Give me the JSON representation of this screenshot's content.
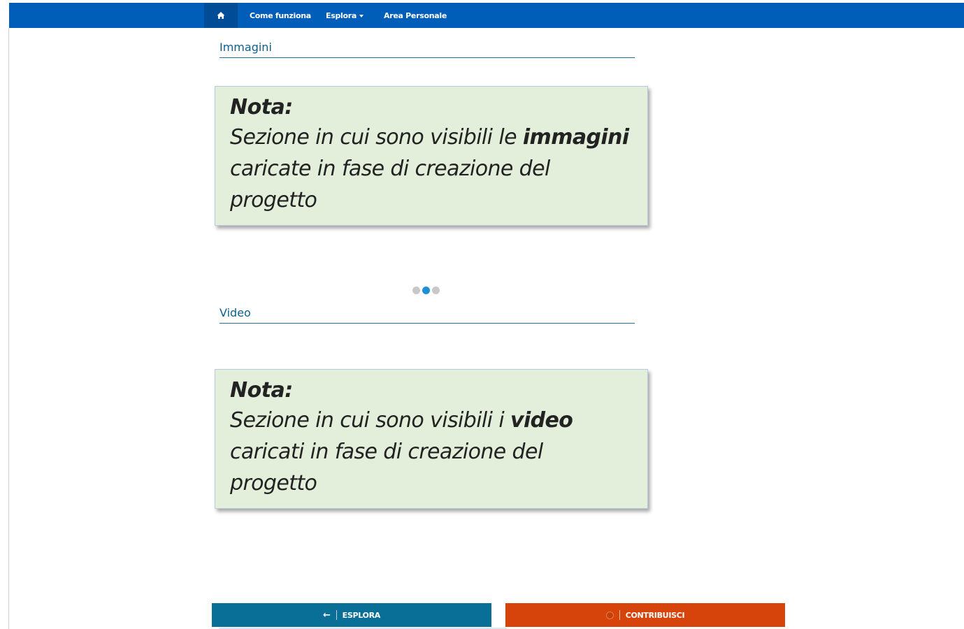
{
  "nav": {
    "home_icon": "home-icon",
    "items": [
      {
        "label": "Come funziona"
      },
      {
        "label": "Esplora"
      },
      {
        "label": "Area Personale"
      }
    ]
  },
  "sections": {
    "images_heading": "Immagini",
    "video_heading": "Video"
  },
  "notes": [
    {
      "title": "Nota:",
      "text_before": "Sezione in cui sono visibili le ",
      "text_bold": "immagini",
      "text_after": " caricate in fase di creazione del progetto"
    },
    {
      "title": "Nota:",
      "text_before": "Sezione in cui sono visibili i ",
      "text_bold": "video",
      "text_after": " caricati in fase di creazione del progetto"
    }
  ],
  "carousel": {
    "dot_count": 3,
    "active_index": 1
  },
  "buttons": {
    "explore_label": "ESPLORA",
    "contribute_label": "CONTRIBUISCI"
  },
  "colors": {
    "navbar": "#005eb8",
    "note_background": "#e3eedb",
    "explore_button": "#0a6f97",
    "contribute_button": "#d6440c",
    "active_dot": "#1e90d8"
  }
}
